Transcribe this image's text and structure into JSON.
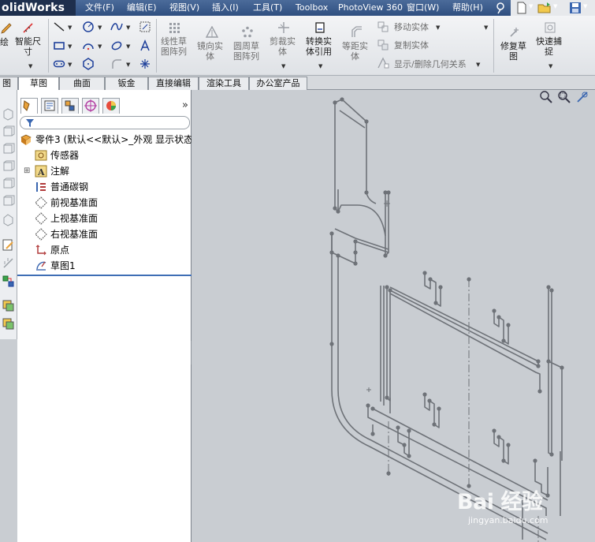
{
  "menubar": {
    "brand": "olidWorks",
    "items": [
      {
        "label": "文件(F)"
      },
      {
        "label": "编辑(E)"
      },
      {
        "label": "视图(V)"
      },
      {
        "label": "插入(I)"
      },
      {
        "label": "工具(T)"
      },
      {
        "label": "Toolbox"
      },
      {
        "label": "PhotoView 360"
      },
      {
        "label": "窗口(W)"
      },
      {
        "label": "帮助(H)"
      }
    ]
  },
  "toolbar": {
    "sketch_label": "绘",
    "smart_dim_label": "智能尺\n寸",
    "linear_pattern_label": "线性草\n图阵列",
    "mirror_label": "镜向实\n体",
    "circular_pattern_label": "圆周草\n图阵列",
    "trim_label": "剪裁实\n体",
    "convert_label": "转换实\n体引用",
    "offset_label": "等距实\n体",
    "move_label": "移动实体",
    "copy_label": "复制实体",
    "display_relations_label": "显示/删除几何关系",
    "repair_label": "修复草\n图",
    "quick_snap_label": "快速捕\n捉"
  },
  "tabs": [
    {
      "label": "图"
    },
    {
      "label": "草图"
    },
    {
      "label": "曲面"
    },
    {
      "label": "钣金"
    },
    {
      "label": "直接编辑"
    },
    {
      "label": "渲染工具"
    },
    {
      "label": "办公室产品"
    }
  ],
  "feature_tree": {
    "root": "零件3  (默认<<默认>_外观 显示状态",
    "items": [
      {
        "label": "传感器",
        "icon": "sensor-icon"
      },
      {
        "label": "注解",
        "icon": "annotation-icon"
      },
      {
        "label": "普通碳钢",
        "icon": "material-icon"
      },
      {
        "label": "前视基准面",
        "icon": "plane-icon"
      },
      {
        "label": "上视基准面",
        "icon": "plane-icon"
      },
      {
        "label": "右视基准面",
        "icon": "plane-icon"
      },
      {
        "label": "原点",
        "icon": "origin-icon"
      },
      {
        "label": "草图1",
        "icon": "sketch-icon"
      }
    ]
  },
  "watermark": {
    "brand": "Bai  经验",
    "url": "jingyan.baidu.com"
  },
  "colors": {
    "menubar": "#2f4f80",
    "accent": "#3f6eb5",
    "viewport_bg": "#c9cdd2",
    "sketch_line": "#6e7278"
  }
}
